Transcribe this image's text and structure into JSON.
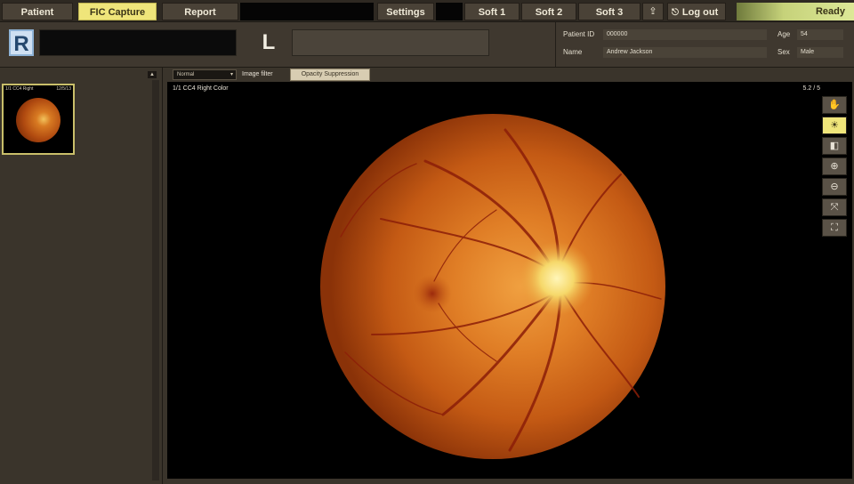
{
  "topbar": {
    "tabs": [
      {
        "label": "Patient",
        "active": false
      },
      {
        "label": "FIC Capture",
        "active": true
      },
      {
        "label": "Report",
        "active": false
      }
    ],
    "settings_label": "Settings",
    "soft_buttons": [
      "Soft 1",
      "Soft 2",
      "Soft 3"
    ],
    "upload_icon": "upload-icon",
    "logout_label": "Log out",
    "logout_icon": "logout-icon",
    "status": "Ready"
  },
  "eyes": {
    "right_label": "R",
    "left_label": "L",
    "right_field": "",
    "left_field": ""
  },
  "patient": {
    "id_label": "Patient ID",
    "id_value": "000000",
    "name_label": "Name",
    "name_value": "Andrew Jackson",
    "age_label": "Age",
    "age_value": "54",
    "sex_label": "Sex",
    "sex_value": "Male"
  },
  "thumbnails": [
    {
      "caption_left": "1/1 CC4 Right",
      "caption_right": "12/5/13"
    }
  ],
  "viewer": {
    "mode_select": "Normal",
    "filter_label": "Image filter",
    "filter_button": "Opacity Suppression",
    "image_title": "1/1 CC4 Right Color",
    "zoom": "5.2 / 5",
    "tools": [
      "hand-icon",
      "brightness-icon",
      "compare-icon",
      "zoom-in-icon",
      "zoom-out-icon",
      "fit-icon",
      "fullscreen-icon"
    ]
  },
  "colors": {
    "accent": "#efe57a",
    "status_bar": "#dde897",
    "eye_r_button": "#cfe0f2"
  }
}
